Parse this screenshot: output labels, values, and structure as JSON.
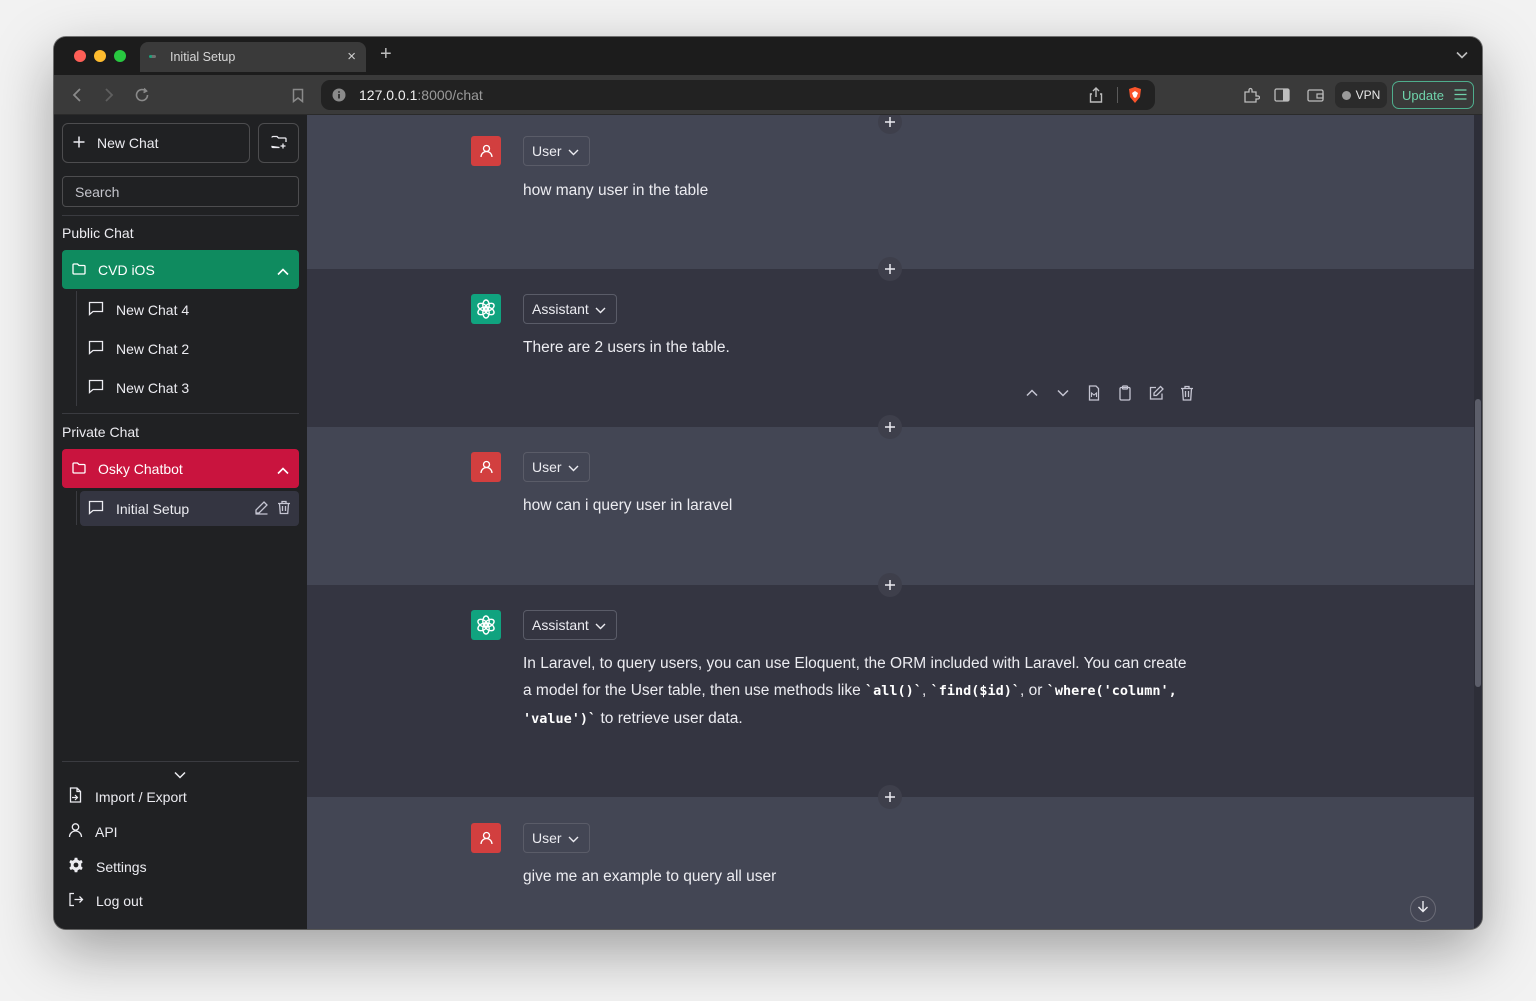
{
  "browser": {
    "tab_title": "Initial Setup",
    "url_host": "127.0.0.1",
    "url_path": ":8000/chat",
    "vpn_label": "VPN",
    "update_label": "Update"
  },
  "sidebar": {
    "new_chat_label": "New Chat",
    "search_placeholder": "Search",
    "public_label": "Public Chat",
    "public_folder": {
      "name": "CVD iOS",
      "color": "#0f8b5f",
      "chats": [
        "New Chat 4",
        "New Chat 2",
        "New Chat 3"
      ]
    },
    "private_label": "Private Chat",
    "private_folder": {
      "name": "Osky Chatbot",
      "color": "#c9143e",
      "chats": [
        "Initial Setup"
      ]
    },
    "footer": {
      "import_export": "Import / Export",
      "api": "API",
      "settings": "Settings",
      "logout": "Log out"
    }
  },
  "messages": [
    {
      "role": "User",
      "text": "how many user in the table"
    },
    {
      "role": "Assistant",
      "text": "There are 2 users in the table."
    },
    {
      "role": "User",
      "text": "how can i query user in laravel"
    },
    {
      "role": "Assistant",
      "text_parts": {
        "a": "In Laravel, to query users, you can use Eloquent, the ORM included with Laravel. You can create a model for the User table, then use methods like ",
        "c1": "`all()`",
        "b": ", ",
        "c2": "`find($id)`",
        "c": ", or ",
        "c3": "`where('column', 'value')`",
        "d": " to retrieve user data."
      }
    },
    {
      "role": "User",
      "text": "give me an example to query all user"
    }
  ],
  "colors": {
    "user_avatar": "#d23f3f",
    "assistant_avatar": "#10a37f",
    "update_accent": "#6fd3ab"
  }
}
